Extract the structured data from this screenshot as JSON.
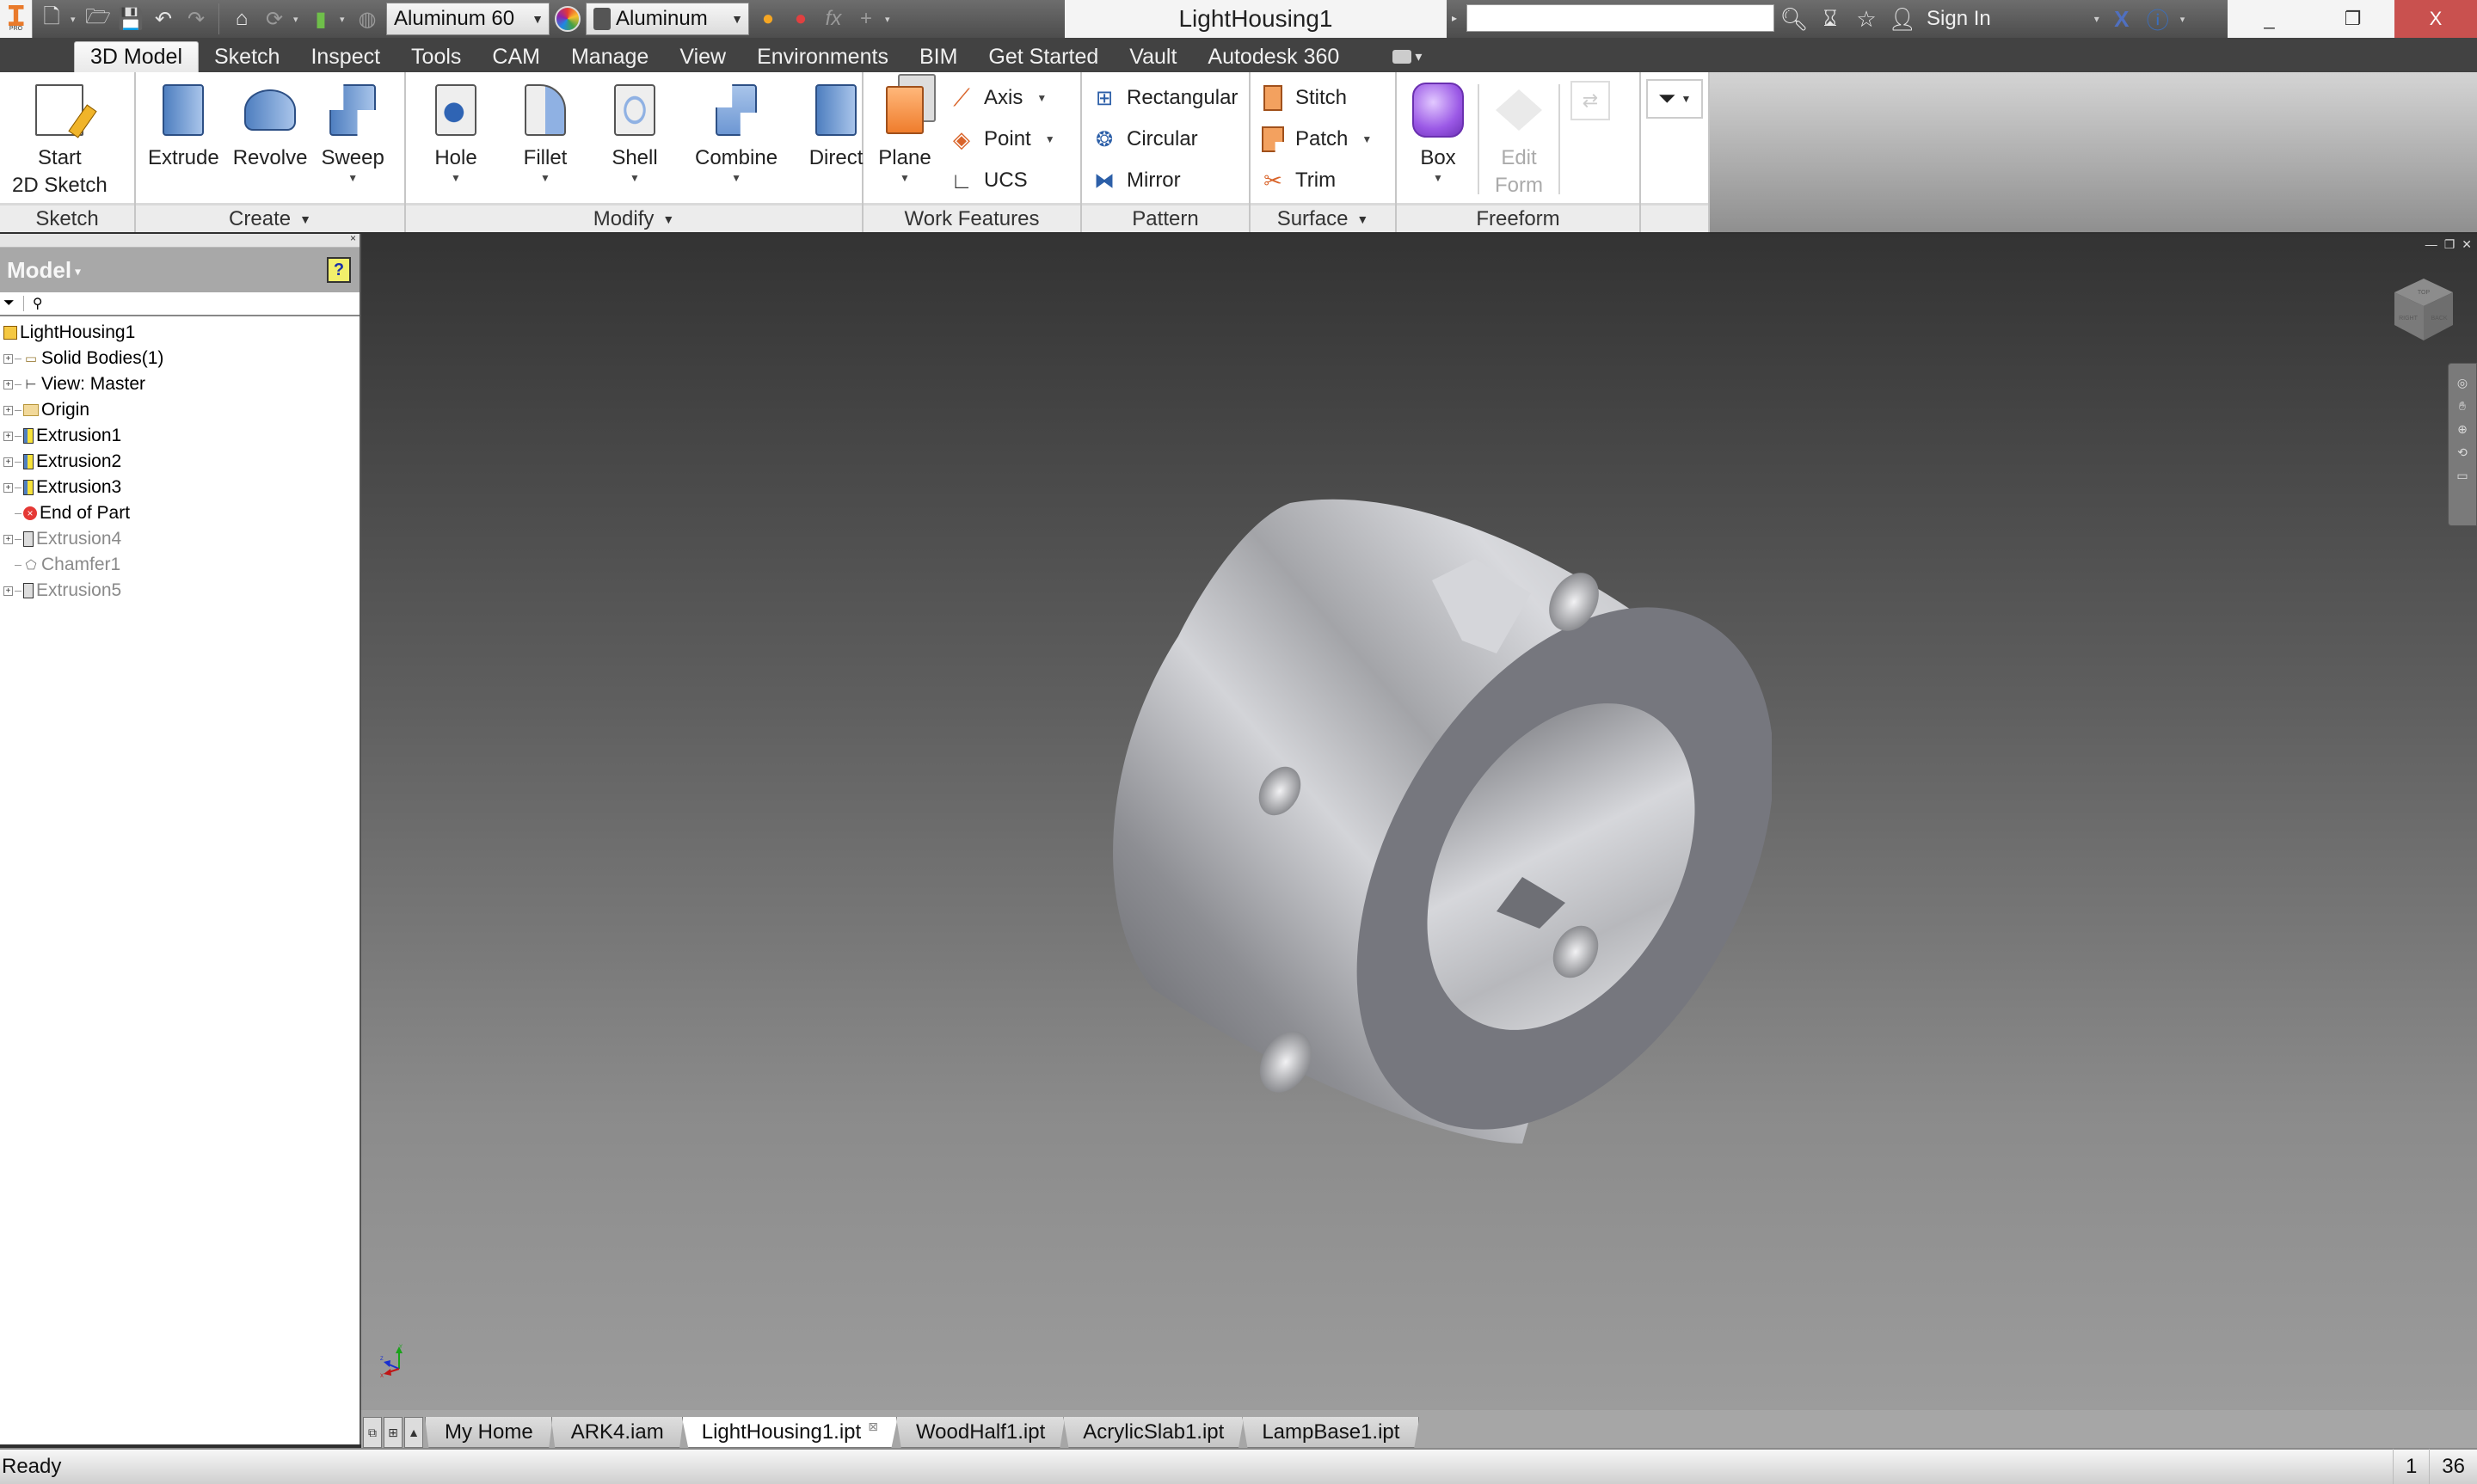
{
  "app": {
    "logo_badge": "PRO",
    "document_title": "LightHousing1"
  },
  "quick_access": {
    "icons": [
      "new-icon",
      "open-icon",
      "save-icon",
      "undo-icon",
      "redo-icon",
      "home-icon",
      "update-icon",
      "select-icon",
      "appearance-icon"
    ],
    "material_value": "Aluminum 60",
    "appearance_value": "Aluminum",
    "trailing_icons": [
      "adjust-appearance-icon",
      "clear-appearance-icon",
      "parameters-fx-icon",
      "add-icon",
      "customize-dropdown-icon"
    ]
  },
  "search": {
    "value": ""
  },
  "account": {
    "sign_in_label": "Sign In"
  },
  "window_controls": {
    "minimize": "_",
    "restore": "❐",
    "close": "X"
  },
  "ribbon_tabs": [
    {
      "label": "3D Model",
      "active": true
    },
    {
      "label": "Sketch"
    },
    {
      "label": "Inspect"
    },
    {
      "label": "Tools"
    },
    {
      "label": "CAM"
    },
    {
      "label": "Manage"
    },
    {
      "label": "View"
    },
    {
      "label": "Environments"
    },
    {
      "label": "BIM"
    },
    {
      "label": "Get Started"
    },
    {
      "label": "Vault"
    },
    {
      "label": "Autodesk 360"
    }
  ],
  "ribbon": {
    "sketch": {
      "title": "Sketch",
      "start_line1": "Start",
      "start_line2": "2D Sketch"
    },
    "create": {
      "title": "Create",
      "extrude": "Extrude",
      "revolve": "Revolve",
      "sweep": "Sweep"
    },
    "modify": {
      "title": "Modify",
      "hole": "Hole",
      "fillet": "Fillet",
      "shell": "Shell",
      "combine": "Combine",
      "direct": "Direct"
    },
    "work_features": {
      "title": "Work Features",
      "plane": "Plane",
      "axis": "Axis",
      "point": "Point",
      "ucs": "UCS"
    },
    "pattern": {
      "title": "Pattern",
      "rectangular": "Rectangular",
      "circular": "Circular",
      "mirror": "Mirror"
    },
    "surface": {
      "title": "Surface",
      "stitch": "Stitch",
      "patch": "Patch",
      "trim": "Trim"
    },
    "freeform": {
      "title": "Freeform",
      "box": "Box",
      "edit_form_line1": "Edit",
      "edit_form_line2": "Form"
    }
  },
  "browser": {
    "title": "Model",
    "help": "?",
    "tree": [
      {
        "label": "LightHousing1",
        "icon": "part-icon",
        "level": 0
      },
      {
        "label": "Solid Bodies(1)",
        "icon": "solid-bodies-icon",
        "expandable": true
      },
      {
        "label": "View: Master",
        "icon": "view-rep-icon",
        "expandable": true
      },
      {
        "label": "Origin",
        "icon": "folder-icon",
        "expandable": true
      },
      {
        "label": "Extrusion1",
        "icon": "extrusion-icon",
        "expandable": true
      },
      {
        "label": "Extrusion2",
        "icon": "extrusion-icon",
        "expandable": true
      },
      {
        "label": "Extrusion3",
        "icon": "extrusion-icon",
        "expandable": true
      },
      {
        "label": "End of Part",
        "icon": "end-of-part-icon"
      },
      {
        "label": "Extrusion4",
        "icon": "extrusion-icon",
        "expandable": true,
        "suppressed": true
      },
      {
        "label": "Chamfer1",
        "icon": "chamfer-icon",
        "suppressed": true
      },
      {
        "label": "Extrusion5",
        "icon": "extrusion-icon",
        "expandable": true,
        "suppressed": true
      }
    ]
  },
  "viewcube": {
    "faces": [
      "TOP",
      "RIGHT",
      "BACK"
    ]
  },
  "triad": {
    "x": "X",
    "y": "Y",
    "z": "Z"
  },
  "document_tabs": [
    {
      "label": "My Home"
    },
    {
      "label": "ARK4.iam"
    },
    {
      "label": "LightHousing1.ipt",
      "active": true
    },
    {
      "label": "WoodHalf1.ipt"
    },
    {
      "label": "AcrylicSlab1.ipt"
    },
    {
      "label": "LampBase1.ipt"
    }
  ],
  "status": {
    "text": "Ready",
    "cell1": "1",
    "cell2": "36"
  }
}
